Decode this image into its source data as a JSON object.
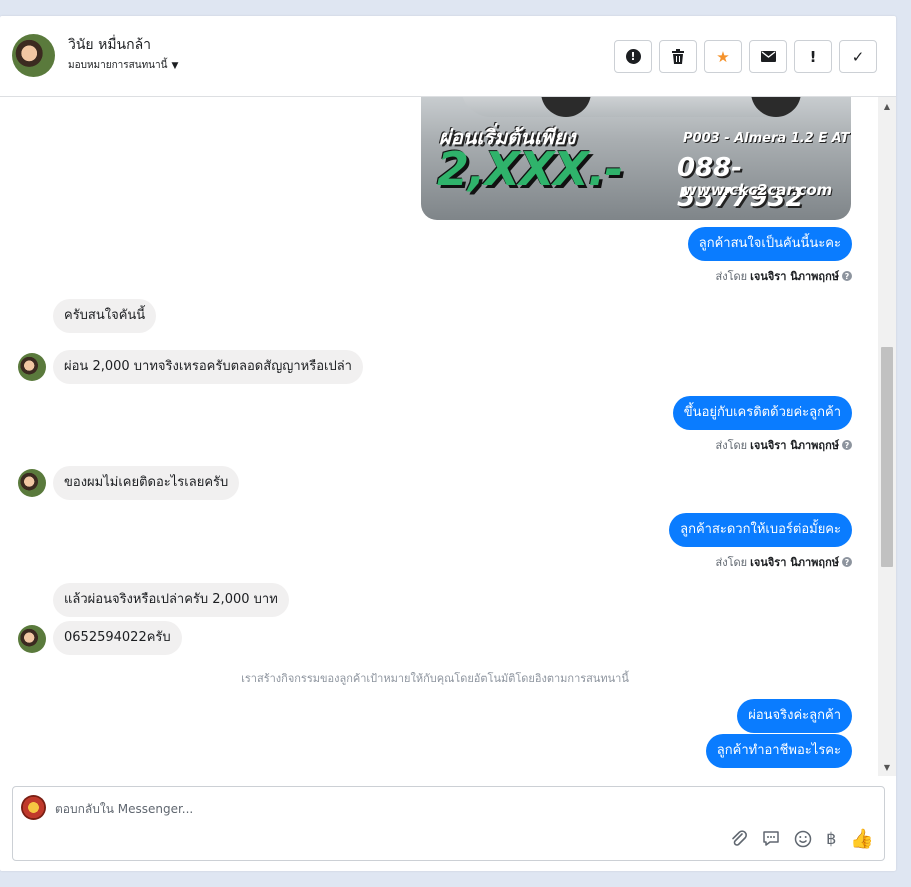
{
  "header": {
    "contact_name": "วินัย หมื่นกล้า",
    "assign_label": "มอบหมายการสนทนานี้",
    "actions": [
      {
        "name": "spam-button",
        "icon": "alert-circle-icon"
      },
      {
        "name": "delete-button",
        "icon": "trash-icon"
      },
      {
        "name": "star-button",
        "icon": "star-icon"
      },
      {
        "name": "mark-unread-button",
        "icon": "envelope-icon"
      },
      {
        "name": "follow-up-button",
        "icon": "exclamation-icon"
      },
      {
        "name": "mark-done-button",
        "icon": "check-icon"
      }
    ]
  },
  "image_attachment": {
    "promo_text": "ผ่อนเริ่มต้นเพียง",
    "price_text": "2,XXX.-",
    "model_text": "P003 - Almera 1.2 E AT",
    "phone_text": "088-5577932",
    "website_text": "www.ckc2car.com"
  },
  "sent_by": {
    "prefix": "ส่งโดย",
    "name": "เจนจิรา นิภาพฤกษ์",
    "help": "?"
  },
  "messages": [
    {
      "dir": "out",
      "text": "ลูกค้าสนใจเป็นคันนี้นะคะ"
    },
    {
      "dir": "in",
      "text": "ครับสนใจคันนี้"
    },
    {
      "dir": "in",
      "text": "ผ่อน 2,000 บาทจริงเหรอครับตลอดสัญญาหรือเปล่า"
    },
    {
      "dir": "out",
      "text": "ขึ้นอยู่กับเครดิตด้วยค่ะลูกค้า"
    },
    {
      "dir": "in",
      "text": "ของผมไม่เคยติดอะไรเลยครับ"
    },
    {
      "dir": "out",
      "text": "ลูกค้าสะดวกให้เบอร์ต่อมั้ยคะ"
    },
    {
      "dir": "in",
      "text": "แล้วผ่อนจริงหรือเปล่าครับ 2,000 บาท"
    },
    {
      "dir": "in",
      "text": "0652594022ครับ"
    },
    {
      "dir": "out",
      "text": "ผ่อนจริงค่ะลูกค้า"
    },
    {
      "dir": "out",
      "text": "ลูกค้าทำอาชีพอะไรคะ"
    }
  ],
  "system_note": "เราสร้างกิจกรรมของลูกค้าเป้าหมายให้กับคุณโดยอัตโนมัติโดยอิงตามการสนทนานี้",
  "composer": {
    "placeholder": "ตอบกลับใน Messenger...",
    "tools": [
      "paperclip-icon",
      "saved-reply-icon",
      "emoji-icon",
      "baht-icon",
      "thumbs-up-icon"
    ]
  }
}
